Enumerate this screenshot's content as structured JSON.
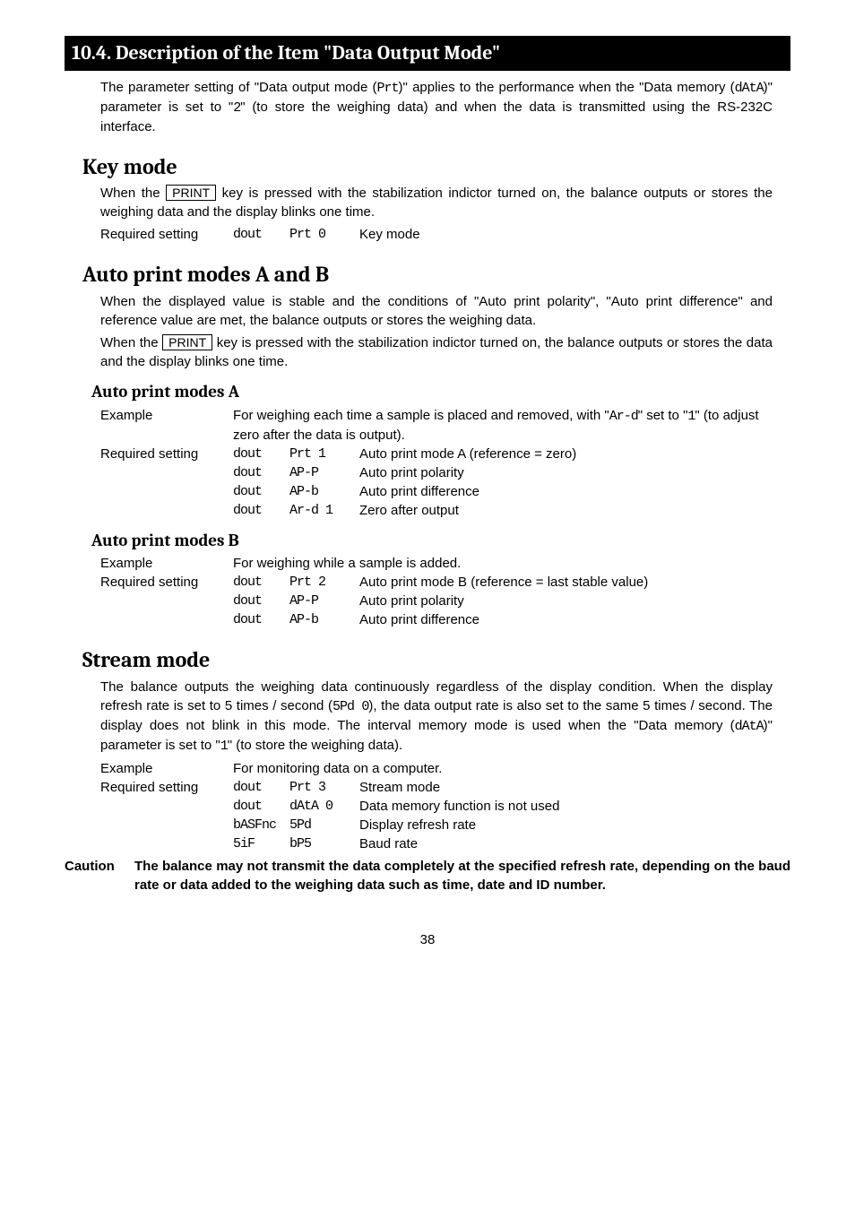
{
  "banner": "10.4. Description of the Item \"Data Output Mode\"",
  "intro": {
    "p1a": "The parameter setting of \"Data output mode (",
    "p1seg": "Prt",
    "p1b": ")\" applies to the performance when the \"Data memory (",
    "p1seg2": "dAtA",
    "p1c": ")\" parameter is set to \"",
    "p1seg3": "2",
    "p1d": "\" (to store the weighing data) and when the data is transmitted using the RS-232C interface."
  },
  "keymode": {
    "h": "Key mode",
    "p1a": "When the ",
    "key": "PRINT",
    "p1b": " key is pressed with the stabilization indictor turned on, the balance outputs or stores the weighing data and the display blinks one time.",
    "req": "Required setting",
    "c1": "dout",
    "c2": "Prt 0",
    "c3": "Key mode"
  },
  "autoab": {
    "h": "Auto print modes A and B",
    "p1": "When the displayed value is stable and the conditions of \"Auto print polarity\", \"Auto print difference\" and reference value are met, the balance outputs or stores the weighing data.",
    "p2a": "When the ",
    "key": "PRINT",
    "p2b": " key is pressed with the stabilization indictor turned on, the balance outputs or stores the data and the display blinks one time."
  },
  "modeA": {
    "h": "Auto print modes A",
    "ex_label": "Example",
    "ex_a": "For weighing each time a sample is placed and removed, with \"",
    "ex_seg": "Ar-d",
    "ex_b": "\" set to \"",
    "ex_seg2": "1",
    "ex_c": "\" (to adjust zero after the data is output).",
    "req_label": "Required setting",
    "rows": [
      {
        "c1": "dout",
        "c2": "Prt 1",
        "c3": "Auto print mode A (reference = zero)"
      },
      {
        "c1": "dout",
        "c2": "AP-P",
        "c3": "Auto print polarity"
      },
      {
        "c1": "dout",
        "c2": "AP-b",
        "c3": "Auto print difference"
      },
      {
        "c1": "dout",
        "c2": "Ar-d 1",
        "c3": "Zero after output"
      }
    ]
  },
  "modeB": {
    "h": "Auto print modes B",
    "ex_label": "Example",
    "ex": "For weighing while a sample is added.",
    "req_label": "Required setting",
    "rows": [
      {
        "c1": "dout",
        "c2": "Prt 2",
        "c3": "Auto print mode B (reference = last stable value)"
      },
      {
        "c1": "dout",
        "c2": "AP-P",
        "c3": "Auto print polarity"
      },
      {
        "c1": "dout",
        "c2": "AP-b",
        "c3": "Auto print difference"
      }
    ]
  },
  "stream": {
    "h": "Stream mode",
    "p1a": "The balance outputs the weighing data continuously regardless of the display condition. When the display refresh rate is set to 5 times / second (",
    "p1seg": "5Pd 0",
    "p1b": "), the data output rate is also set to the same 5 times / second. The display does not blink in this mode. The interval memory mode is used when the \"Data memory (",
    "p1seg2": "dAtA",
    "p1c": ")\" parameter is set to \"",
    "p1seg3": "1",
    "p1d": "\" (to store the weighing data).",
    "ex_label": "Example",
    "ex": "For monitoring data on a computer.",
    "req_label": "Required setting",
    "rows": [
      {
        "c1": "dout",
        "c2": "Prt 3",
        "c3": "Stream mode"
      },
      {
        "c1": "dout",
        "c2": "dAtA 0",
        "c3": "Data memory function is not used"
      },
      {
        "c1": "bASFnc",
        "c2": "5Pd",
        "c3": "Display refresh rate"
      },
      {
        "c1": "5iF",
        "c2": "bP5",
        "c3": "Baud rate"
      }
    ]
  },
  "caution": {
    "label": "Caution",
    "text": "The balance may not transmit the data completely at the specified refresh rate, depending on the baud rate or data added to the weighing data such as time, date and ID number."
  },
  "page": "38"
}
